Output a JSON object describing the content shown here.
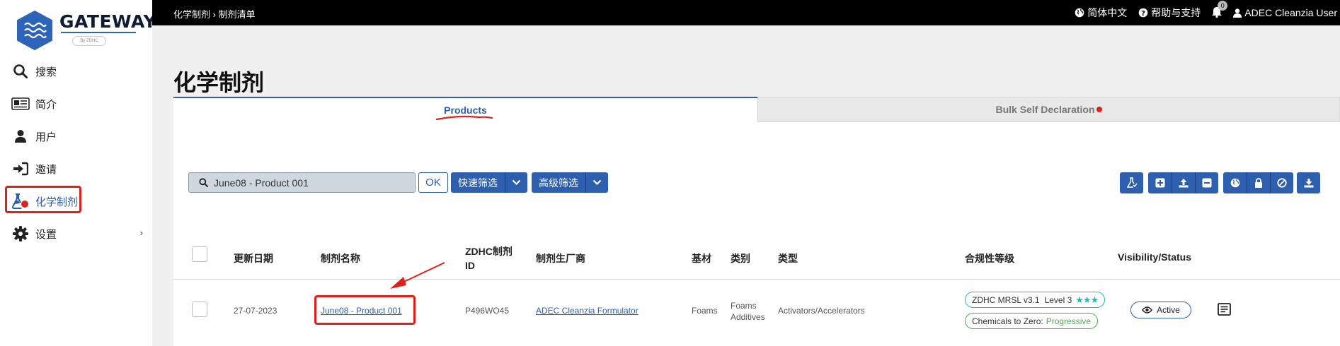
{
  "brand": {
    "name": "GATEWAY",
    "tagline": "By ZDHC"
  },
  "sidebar": {
    "items": [
      {
        "label": "搜索"
      },
      {
        "label": "简介"
      },
      {
        "label": "用户"
      },
      {
        "label": "邀请"
      },
      {
        "label": "化学制剂"
      },
      {
        "label": "设置"
      }
    ]
  },
  "topbar": {
    "breadcrumb": {
      "root": "化学制剂",
      "separator": "›",
      "current": "制剂清单"
    },
    "language": "简体中文",
    "help": "帮助与支持",
    "notifications_count": "0",
    "user": "ADEC Cleanzia User"
  },
  "page": {
    "title": "化学制剂"
  },
  "tabs": [
    {
      "label": "Products"
    },
    {
      "label": "Bulk Self Declaration"
    }
  ],
  "toolbar": {
    "search_value": "June08 - Product 001",
    "ok_label": "OK",
    "quick_filter_label": "快速筛选",
    "advanced_filter_label": "高级筛选"
  },
  "table": {
    "headers": {
      "updated": "更新日期",
      "name": "制剂名称",
      "zdhc_id_line1": "ZDHC制剂",
      "zdhc_id_line2": "ID",
      "manufacturer": "制剂生厂商",
      "substrate": "基材",
      "category": "类别",
      "type": "类型",
      "compliance": "合规性等级",
      "visibility": "Visibility/Status"
    },
    "rows": [
      {
        "updated": "27-07-2023",
        "name": "June08 - Product 001",
        "zdhc_id": "P496WO45",
        "manufacturer": "ADEC Cleanzia Formulator",
        "substrate": "Foams",
        "category_line1": "Foams",
        "category_line2": "Additives",
        "type": "Activators/Accelerators",
        "mrsl": {
          "prefix": "ZDHC MRSL v3.1",
          "level": "Level 3",
          "stars": "★★★"
        },
        "ctz": {
          "prefix": "Chemicals to Zero:",
          "value": "Progressive"
        },
        "status": "Active"
      }
    ]
  },
  "colors": {
    "primary": "#2d5fae",
    "annotation": "#e0211b",
    "topbar": "#000000",
    "teal": "#22b8b8",
    "green": "#4caf50"
  }
}
